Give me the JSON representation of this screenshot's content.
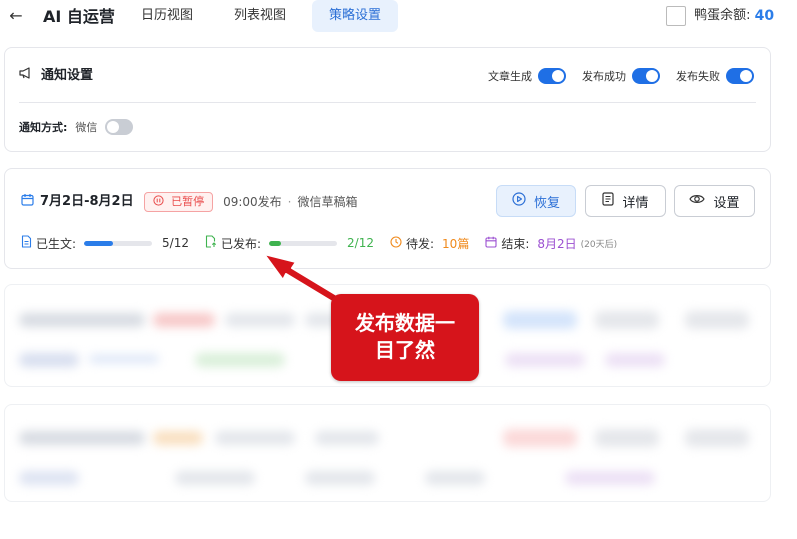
{
  "header": {
    "back_glyph": "←",
    "app_title": "AI 自运营",
    "tabs": [
      {
        "label": "日历视图",
        "active": false
      },
      {
        "label": "列表视图",
        "active": false
      },
      {
        "label": "策略设置",
        "active": true
      }
    ],
    "balance_label": "鸭蛋余额:",
    "balance_value": "40"
  },
  "notify": {
    "title": "通知设置",
    "icon": "megaphone-icon",
    "switches": [
      {
        "label": "文章生成",
        "on": true
      },
      {
        "label": "发布成功",
        "on": true
      },
      {
        "label": "发布失败",
        "on": true
      }
    ],
    "method_label": "通知方式:",
    "method_value": "微信",
    "method_on": false
  },
  "plan": {
    "date_range": "7月2日-8月2日",
    "status": "已暂停",
    "time": "09:00发布",
    "separator": "·",
    "channel": "微信草稿箱",
    "buttons": {
      "resume": "恢复",
      "detail": "详情",
      "setting": "设置"
    },
    "stats": {
      "generated_label": "已生文:",
      "generated_value": "5/12",
      "generated_progress": 0.42,
      "published_label": "已发布:",
      "published_value": "2/12",
      "published_progress": 0.17,
      "pending_label": "待发:",
      "pending_value": "10篇",
      "end_label": "结束:",
      "end_value": "8月2日",
      "end_note": "(20天后)"
    },
    "colors": {
      "blue": "#2b7de9",
      "green": "#3fb34f",
      "orange": "#f08a1c",
      "purple": "#9b4fd1",
      "paused_red": "#e94b4b"
    }
  },
  "annotation": {
    "line1": "发布数据一",
    "line2": "目了然",
    "color": "#d6141b"
  }
}
